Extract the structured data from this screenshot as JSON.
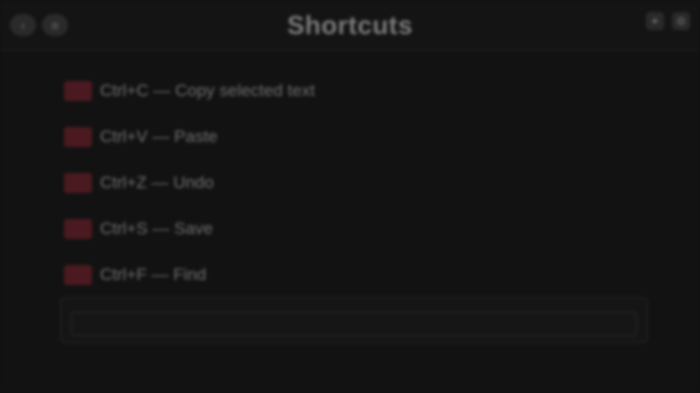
{
  "header": {
    "title": "Shortcuts",
    "left_buttons": [
      {
        "name": "back-icon",
        "glyph": "‹"
      },
      {
        "name": "menu-icon",
        "glyph": "≡"
      }
    ],
    "right_buttons": [
      {
        "name": "pin-icon",
        "glyph": "✦"
      },
      {
        "name": "settings-icon",
        "glyph": "⚙"
      }
    ]
  },
  "shortcuts": [
    {
      "label": "Ctrl+C — Copy selected text"
    },
    {
      "label": "Ctrl+V — Paste"
    },
    {
      "label": "Ctrl+Z — Undo"
    },
    {
      "label": "Ctrl+S — Save"
    },
    {
      "label": "Ctrl+F — Find"
    }
  ],
  "colors": {
    "background": "#121212",
    "flag": "#4a1a20",
    "text": "#6f6f6f"
  }
}
